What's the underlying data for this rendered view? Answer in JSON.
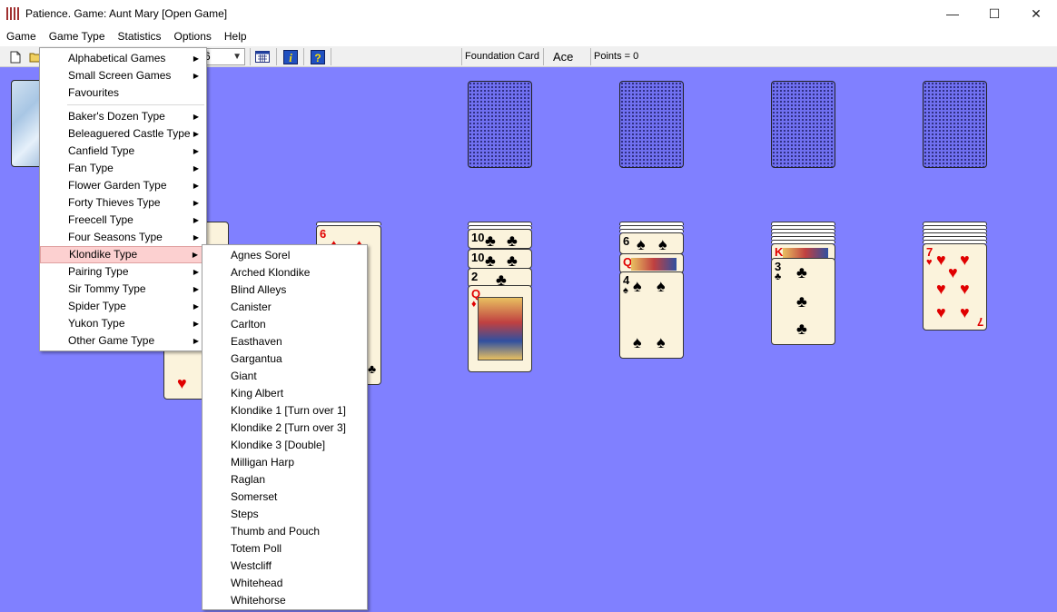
{
  "window": {
    "title": "Patience. Game: Aunt Mary  [Open Game]",
    "controls": {
      "minimize": "—",
      "maximize": "☐",
      "close": "✕"
    }
  },
  "menubar": [
    "Game",
    "Game Type",
    "Statistics",
    "Options",
    "Help"
  ],
  "toolbar": {
    "combo_value": "6",
    "foundation_label": "Foundation Card",
    "foundation_value": "Ace",
    "points_label": "Points = 0"
  },
  "icons": {
    "new": "new-file-icon",
    "open": "open-folder-icon",
    "grid": "calculator-icon",
    "info": "info-icon",
    "help": "help-question-icon"
  },
  "colors": {
    "table": "#8080ff",
    "menu_highlight": "#fcd0d0",
    "card_back": "#7070f0"
  },
  "game_type_menu": {
    "group1": [
      "Alphabetical Games",
      "Small Screen Games",
      "Favourites"
    ],
    "group2": [
      "Baker's Dozen Type",
      "Beleaguered Castle Type",
      "Canfield Type",
      "Fan Type",
      "Flower Garden Type",
      "Forty Thieves Type",
      "Freecell Type",
      "Four Seasons Type",
      "Klondike Type",
      "Pairing Type",
      "Sir Tommy Type",
      "Spider Type",
      "Yukon Type",
      "Other Game Type"
    ],
    "highlighted": "Klondike Type"
  },
  "klondike_submenu": [
    "Agnes Sorel",
    "Arched Klondike",
    "Blind Alleys",
    "Canister",
    "Carlton",
    "Easthaven",
    "Gargantua",
    "Giant",
    "King Albert",
    "Klondike 1 [Turn over 1]",
    "Klondike 2 [Turn over 3]",
    "Klondike 3 [Double]",
    "Milligan Harp",
    "Raglan",
    "Somerset",
    "Steps",
    "Thumb and Pouch",
    "Totem Poll",
    "Westcliff",
    "Whitehead",
    "Whitehorse"
  ],
  "cards": {
    "pile2_top": {
      "rank": "6"
    },
    "pile3_ranks": [
      "10",
      "10",
      "2",
      "Q"
    ],
    "pile4_ranks": [
      "6",
      "Q",
      "4"
    ],
    "pile5_ranks": [
      "K",
      "3"
    ],
    "pile6_top": {
      "rank": "7"
    }
  }
}
